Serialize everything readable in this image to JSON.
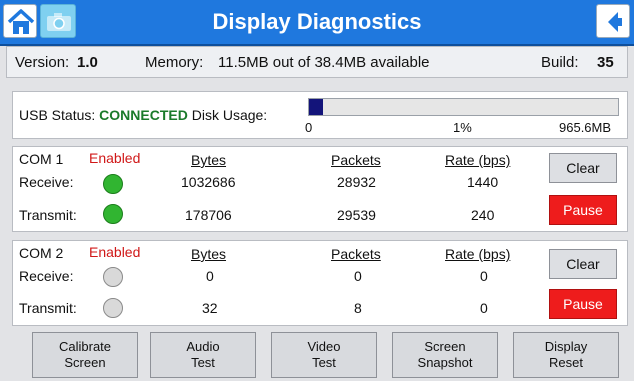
{
  "title": "Display Diagnostics",
  "info": {
    "version_label": "Version:",
    "version": "1.0",
    "memory_label": "Memory:",
    "memory": "11.5MB out of 38.4MB available",
    "build_label": "Build:",
    "build": "35"
  },
  "usb": {
    "status_label": "USB Status:",
    "status": "CONNECTED",
    "disk_label": "Disk Usage:",
    "disk_usage_fraction": 0.01,
    "scale_min": "0",
    "percent": "1%",
    "capacity": "965.6MB"
  },
  "columns": {
    "bytes": "Bytes",
    "packets": "Packets",
    "rate": "Rate (bps)"
  },
  "com1": {
    "name": "COM 1",
    "state": "Enabled",
    "receive_label": "Receive:",
    "transmit_label": "Transmit:",
    "receive": {
      "active": true,
      "bytes": "1032686",
      "packets": "28932",
      "rate": "1440"
    },
    "transmit": {
      "active": true,
      "bytes": "178706",
      "packets": "29539",
      "rate": "240"
    },
    "clear_label": "Clear",
    "pause_label": "Pause"
  },
  "com2": {
    "name": "COM 2",
    "state": "Enabled",
    "receive_label": "Receive:",
    "transmit_label": "Transmit:",
    "receive": {
      "active": false,
      "bytes": "0",
      "packets": "0",
      "rate": "0"
    },
    "transmit": {
      "active": false,
      "bytes": "32",
      "packets": "8",
      "rate": "0"
    },
    "clear_label": "Clear",
    "pause_label": "Pause"
  },
  "bottom_buttons": [
    {
      "line1": "Calibrate",
      "line2": "Screen"
    },
    {
      "line1": "Audio",
      "line2": "Test"
    },
    {
      "line1": "Video",
      "line2": "Test"
    },
    {
      "line1": "Screen",
      "line2": "Snapshot"
    },
    {
      "line1": "Display",
      "line2": "Reset"
    }
  ],
  "icons": {
    "home": "home-icon",
    "camera": "camera-icon",
    "back": "back-arrow-icon"
  },
  "colors": {
    "title_bar": "#1f78de",
    "connected": "#1a7a2a",
    "enabled": "#d01818",
    "led_on": "#31b531",
    "led_off": "#d9d9d9",
    "pause": "#ee1c1c",
    "disk_bar": "#13147a"
  }
}
